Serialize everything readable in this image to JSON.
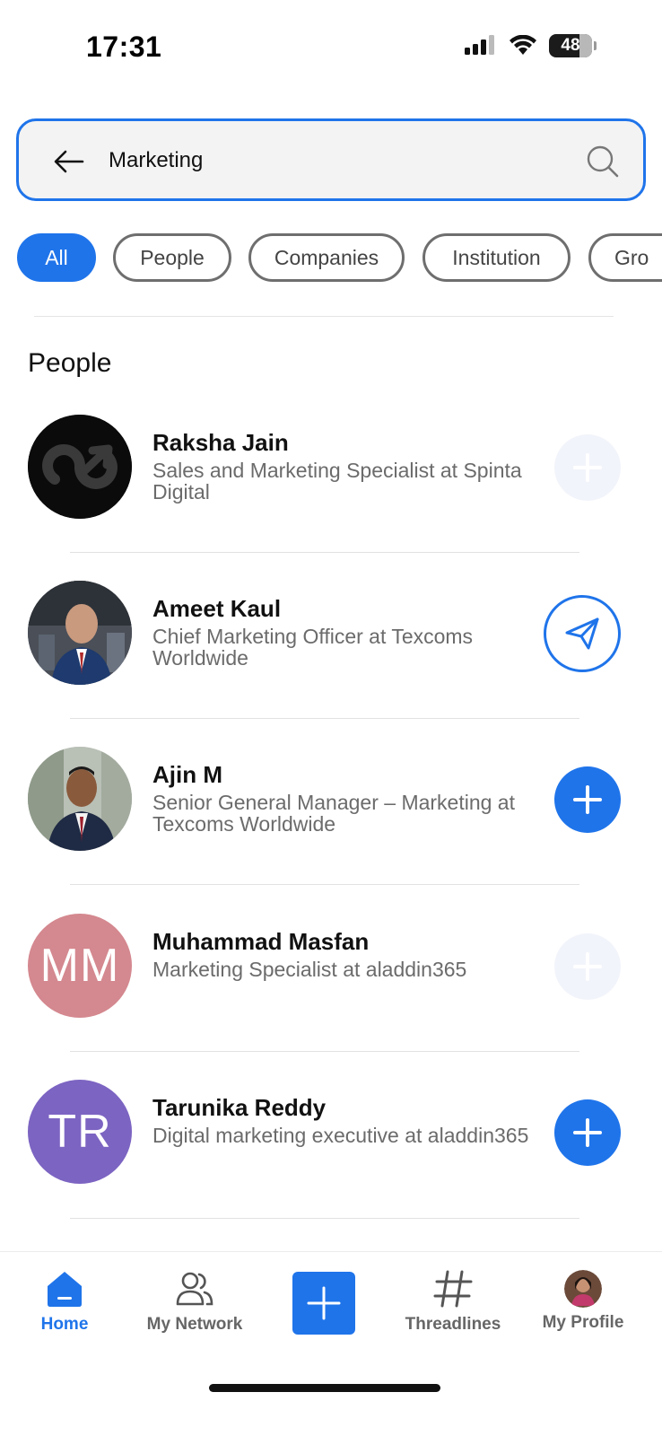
{
  "status_bar": {
    "time": "17:31",
    "battery": "48"
  },
  "search": {
    "query": "Marketing",
    "placeholder": ""
  },
  "filters": [
    {
      "label": "All",
      "active": true
    },
    {
      "label": "People",
      "active": false
    },
    {
      "label": "Companies",
      "active": false
    },
    {
      "label": "Institution",
      "active": false
    },
    {
      "label": "Gro",
      "active": false
    }
  ],
  "section": {
    "title": "People"
  },
  "people": [
    {
      "name": "Raksha Jain",
      "title": "Sales and Marketing Specialist at Spinta Digital",
      "action": "add-disabled",
      "avatar": "logo"
    },
    {
      "name": "Ameet Kaul",
      "title": "Chief Marketing Officer at Texcoms Worldwide",
      "action": "send",
      "avatar": "photo"
    },
    {
      "name": "Ajin M",
      "title": "Senior General Manager – Marketing at Texcoms Worldwide",
      "action": "add",
      "avatar": "photo"
    },
    {
      "name": "Muhammad Masfan",
      "title": "Marketing Specialist at aladdin365",
      "action": "add-disabled",
      "avatar": "initials",
      "initials": "MM",
      "avatar_color": "#d4888f"
    },
    {
      "name": "Tarunika Reddy",
      "title": "Digital marketing executive at aladdin365",
      "action": "add",
      "avatar": "initials",
      "initials": "TR",
      "avatar_color": "#7c64c2"
    }
  ],
  "nav": {
    "home": "Home",
    "network": "My Network",
    "threadlines": "Threadlines",
    "profile": "My Profile"
  },
  "colors": {
    "accent": "#1f74ea",
    "chip_border": "#6e6e6e",
    "secondary_text": "#6b6b6b"
  }
}
